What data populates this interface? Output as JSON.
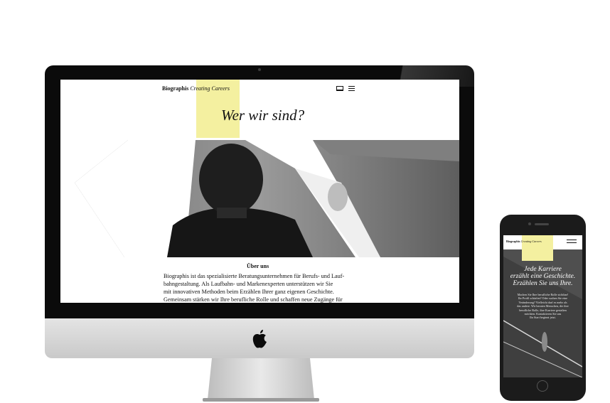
{
  "desktop": {
    "brand_name": "Biographis",
    "brand_tagline": "Creating Careers",
    "headline": "Wer wir sind?",
    "section_title": "Über uns",
    "body_lines": [
      "Biographis ist das spezialisierte Beratungsunternehmen für Berufs- und Lauf-",
      "bahngestaltung. Als Laufbahn- und Markenexperten unterstützen wir Sie",
      "mit innovativen Methoden beim Erzählen Ihrer ganz eigenen Geschichte.",
      "Gemeinsam stärken wir Ihre berufliche Rolle und schaffen neue Zugänge für"
    ],
    "accent_color": "#f4f0a0"
  },
  "mobile": {
    "brand_name": "Biographis",
    "brand_tagline": "Creating Careers",
    "headline_lines": [
      "Jede Karriere",
      "erzählt eine Geschichte.",
      "Erzählen Sie uns Ihre."
    ],
    "body_lines": [
      "Machen Sie Ihre berufliche Rolle sichtbar!",
      "Ihr Profil schärfen? Oder suchen Sie eine",
      "Veränderung? Vielleicht darf es mehr als",
      "das andere. Wir beraten Menschen, die ihre",
      "berufliche Rolle, ihre Karriere gestalten",
      "möchten. Kontaktieren Sie uns",
      "Ihr Start beginnt jetzt."
    ]
  },
  "icons": [
    "apple-logo-icon",
    "mail-icon",
    "menu-icon"
  ]
}
